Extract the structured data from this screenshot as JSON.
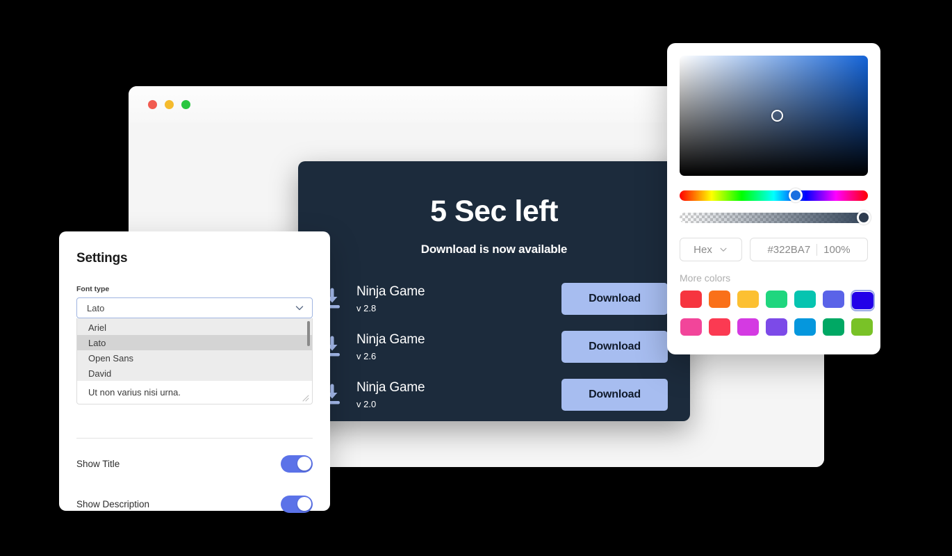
{
  "browser": {
    "traffic_lights": [
      {
        "name": "close",
        "color": "#f15b50"
      },
      {
        "name": "minimize",
        "color": "#f5bb2d"
      },
      {
        "name": "maximize",
        "color": "#28c63f"
      }
    ]
  },
  "download_panel": {
    "title": "5 Sec left",
    "subtitle": "Download is now available",
    "background": "#1c2b3c",
    "button_color": "#a7bdf0",
    "items": [
      {
        "name": "Ninja Game",
        "version": "v 2.8",
        "button_label": "Download"
      },
      {
        "name": "Ninja Game",
        "version": "v 2.6",
        "button_label": "Download"
      },
      {
        "name": "Ninja Game",
        "version": "v 2.0",
        "button_label": "Download"
      }
    ]
  },
  "settings": {
    "title": "Settings",
    "font_type": {
      "label": "Font type",
      "value": "Lato",
      "options": [
        "Ariel",
        "Lato",
        "Open Sans",
        "David"
      ],
      "selected_option": "Lato"
    },
    "description_value": "Ut non varius nisi urna.",
    "toggles": [
      {
        "label": "Show Title",
        "on": true
      },
      {
        "label": "Show Description",
        "on": true
      }
    ],
    "accent_color": "#5b72e8"
  },
  "color_picker": {
    "mode_label": "Hex",
    "hex_value": "#322BA7",
    "alpha_value": "100%",
    "more_colors_label": "More colors",
    "selected_swatch_index": 6,
    "swatches_row1": [
      "#f6353f",
      "#fa7019",
      "#fcc032",
      "#1fd67e",
      "#06c4b0",
      "#5a63e8",
      "#2200e8"
    ],
    "swatches_row2": [
      "#f2459a",
      "#fb3a52",
      "#d43ae2",
      "#7c4ae8",
      "#0597dd",
      "#00a864",
      "#79c227"
    ]
  }
}
